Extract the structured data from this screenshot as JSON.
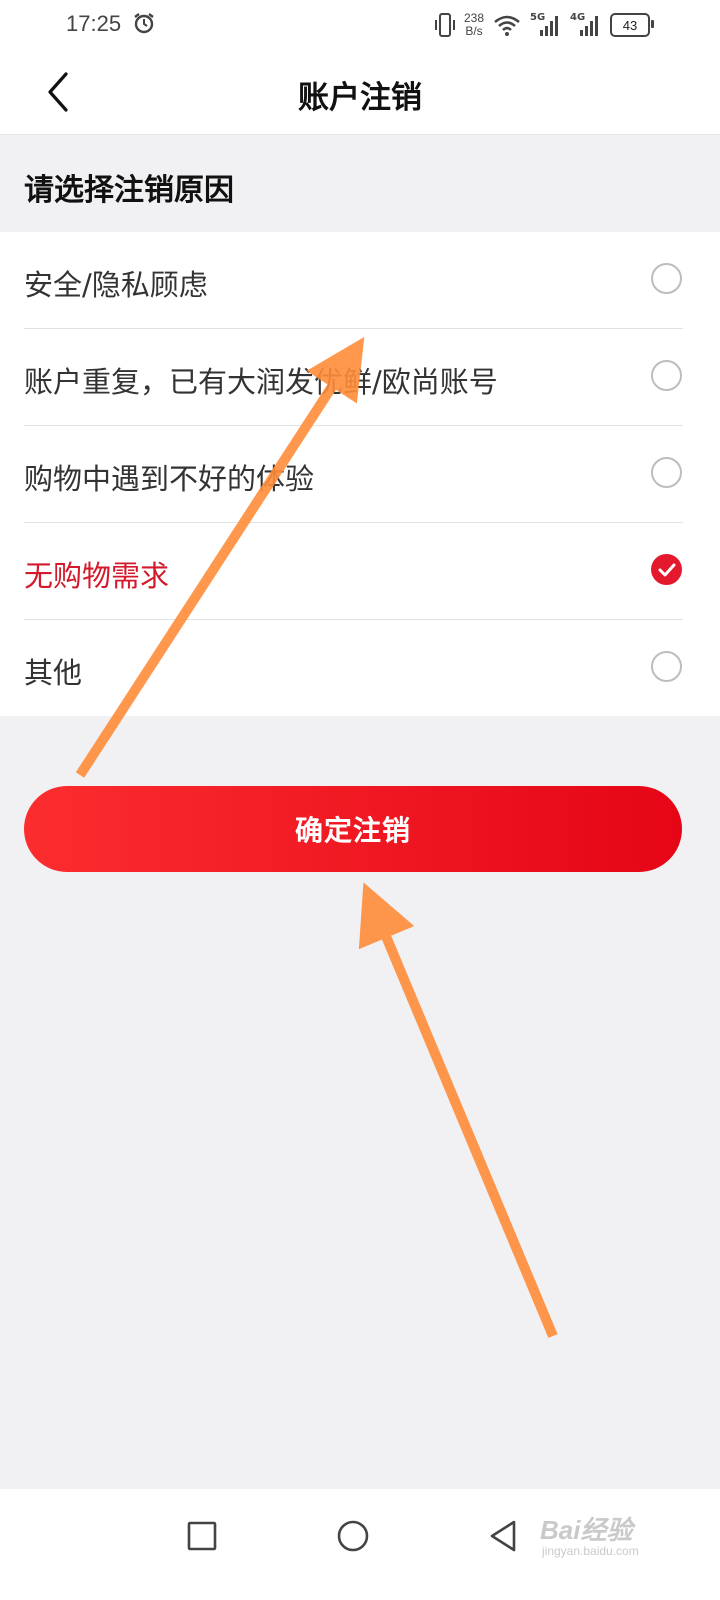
{
  "status_bar": {
    "time": "17:25",
    "net_speed_value": "238",
    "net_speed_unit": "B/s",
    "sim1_label": "5G",
    "sim2_label": "4G",
    "battery": "43",
    "icons": [
      "alarm-icon",
      "vibrate-icon",
      "wifi-icon",
      "signal-icon",
      "battery-icon"
    ]
  },
  "header": {
    "title": "账户注销"
  },
  "section": {
    "title": "请选择注销原因"
  },
  "reasons": [
    {
      "label": "安全/隐私顾虑",
      "selected": false
    },
    {
      "label": "账户重复，已有大润发优鲜/欧尚账号",
      "selected": false
    },
    {
      "label": "购物中遇到不好的体验",
      "selected": false
    },
    {
      "label": "无购物需求",
      "selected": true
    },
    {
      "label": "其他",
      "selected": false
    }
  ],
  "confirm_button": {
    "label": "确定注销"
  },
  "system_nav": {
    "icons": [
      "recents-square-icon",
      "home-circle-icon",
      "back-triangle-icon"
    ]
  },
  "watermark": {
    "text": "Bai经验",
    "sub": "jingyan.baidu.com"
  },
  "colors": {
    "accent": "#e5192d",
    "arrow": "#ff8c3a",
    "background": "#f1f0f2"
  }
}
